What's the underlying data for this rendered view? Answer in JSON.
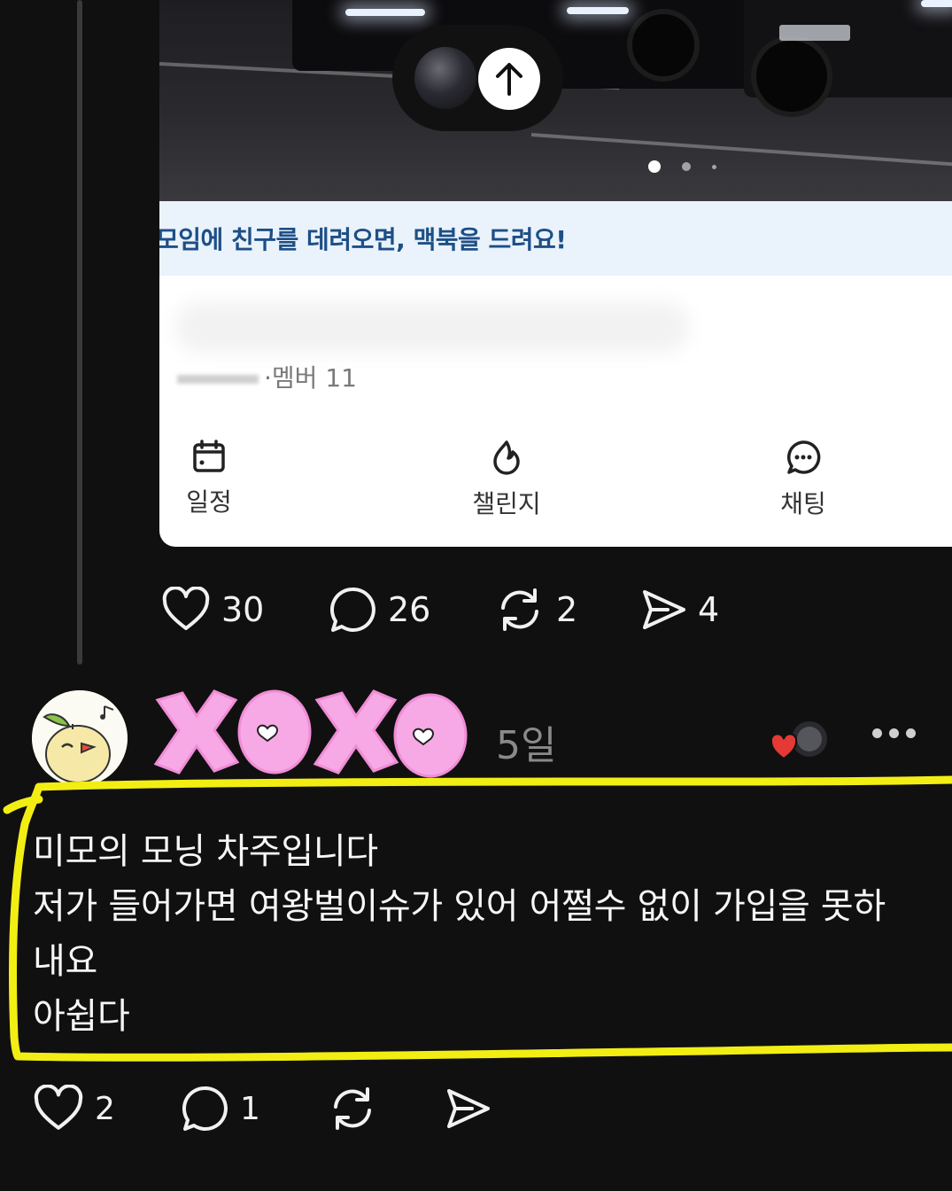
{
  "card": {
    "promo_text": "모임에 친구를 데려오면, 맥북을 드려요!",
    "meta_text": "·멤버 11",
    "tabs": [
      {
        "label": "일정",
        "icon": "calendar-icon"
      },
      {
        "label": "챌린지",
        "icon": "flame-icon"
      },
      {
        "label": "채팅",
        "icon": "chat-bubble-icon"
      }
    ],
    "carousel": {
      "pages": 3,
      "current": 1
    }
  },
  "post1": {
    "likes": "30",
    "comments": "26",
    "reposts": "2",
    "shares": "4"
  },
  "post2": {
    "time": "5일",
    "lines": [
      "미모의 모닝 차주입니다",
      "저가 들어가면 여왕벌이슈가 있어 어쩔수 없이 가입을 못하",
      "내요",
      "아쉽다"
    ],
    "likes": "2",
    "comments": "1"
  },
  "colors": {
    "background": "#101010",
    "card": "#ffffff",
    "promo_bg": "#eaf2fb",
    "promo_text": "#1d4f86",
    "highlight": "#f2ee14",
    "sticker_pink": "#f7a9e6",
    "heart_red": "#e53935"
  }
}
